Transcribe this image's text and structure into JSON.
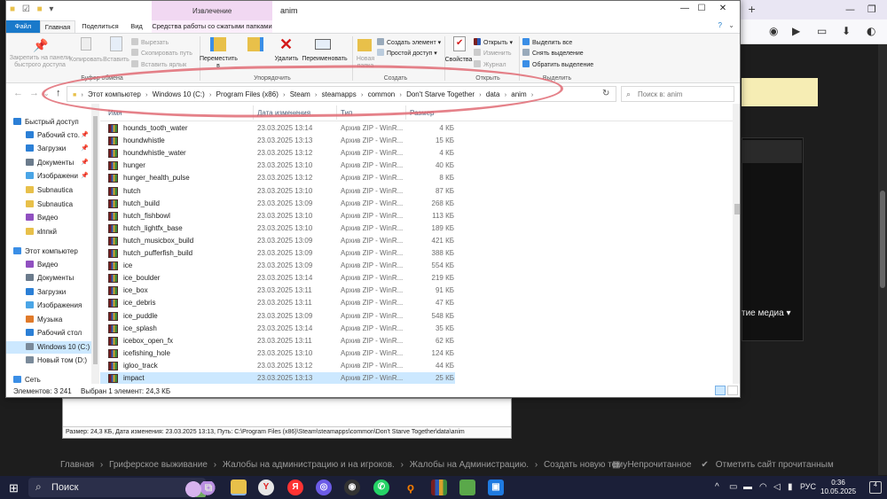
{
  "window": {
    "title": "anim",
    "context_tab": "Извлечение",
    "controls": {
      "minimize": "—",
      "maximize": "☐",
      "close": "✕"
    }
  },
  "ribbon_tabs": [
    "Файл",
    "Главная",
    "Поделиться",
    "Вид",
    "Средства работы со сжатыми папками"
  ],
  "ribbon": {
    "clipboard": {
      "pin_label": "Закрепить на панели быстрого доступа",
      "copy_label": "Копировать",
      "paste_label": "Вставить",
      "cut_label": "Вырезать",
      "copy_path_label": "Скопировать путь",
      "paste_shortcut_label": "Вставить ярлык",
      "group_label": "Буфер обмена"
    },
    "organize": {
      "move_label": "Переместить в",
      "copy_to_label": "Копировать в",
      "delete_label": "Удалить",
      "rename_label": "Переименовать",
      "group_label": "Упорядочить"
    },
    "create": {
      "new_folder_label": "Новая папка",
      "new_item_label": "Создать элемент",
      "easy_access_label": "Простой доступ",
      "group_label": "Создать"
    },
    "open": {
      "properties_label": "Свойства",
      "open_label": "Открыть",
      "edit_label": "Изменить",
      "history_label": "Журнал",
      "group_label": "Открыть"
    },
    "select": {
      "select_all_label": "Выделить все",
      "select_none_label": "Снять выделение",
      "invert_label": "Обратить выделение",
      "group_label": "Выделить"
    }
  },
  "address_bar": {
    "segments": [
      "Этот компьютер",
      "Windows 10 (C:)",
      "Program Files (x86)",
      "Steam",
      "steamapps",
      "common",
      "Don't Starve Together",
      "data",
      "anim"
    ],
    "search_placeholder": "Поиск в: anim"
  },
  "nav_pane": {
    "items": [
      {
        "label": "Быстрый доступ",
        "pinned": false
      },
      {
        "label": "Рабочий сто.",
        "pinned": true
      },
      {
        "label": "Загрузки",
        "pinned": true
      },
      {
        "label": "Документы",
        "pinned": true
      },
      {
        "label": "Изображени",
        "pinned": true
      },
      {
        "label": "Subnautica",
        "pinned": false
      },
      {
        "label": "Subnautica",
        "pinned": false
      },
      {
        "label": "Видео",
        "pinned": false
      },
      {
        "label": "кlппкй",
        "pinned": false
      },
      {
        "label": "Этот компьютер",
        "pinned": false
      },
      {
        "label": "Видео",
        "pinned": false
      },
      {
        "label": "Документы",
        "pinned": false
      },
      {
        "label": "Загрузки",
        "pinned": false
      },
      {
        "label": "Изображения",
        "pinned": false
      },
      {
        "label": "Музыка",
        "pinned": false
      },
      {
        "label": "Рабочий стол",
        "pinned": false
      },
      {
        "label": "Windows 10 (C:)",
        "pinned": false
      },
      {
        "label": "Новый том (D:)",
        "pinned": false
      },
      {
        "label": "Сеть",
        "pinned": false
      }
    ],
    "icon_colors": [
      "#2b7fd6",
      "#2b7fd6",
      "#2b7fd6",
      "#6b7b8c",
      "#4aa5e6",
      "#e8c04a",
      "#e8c04a",
      "#9050c0",
      "#e8c04a",
      "#3a8ee6",
      "#9050c0",
      "#6b7b8c",
      "#2b7fd6",
      "#4aa5e6",
      "#e07a2a",
      "#2b7fd6",
      "#7a8a9a",
      "#7a8a9a",
      "#3a8ee6"
    ]
  },
  "file_list": {
    "columns": {
      "name": "Имя",
      "date": "Дата изменения",
      "type": "Тип",
      "size": "Размер"
    },
    "rows": [
      {
        "name": "hounds_tooth_water",
        "date": "23.03.2025 13:14",
        "type": "Архив ZIP - WinR...",
        "size": "4 КБ"
      },
      {
        "name": "houndwhistle",
        "date": "23.03.2025 13:13",
        "type": "Архив ZIP - WinR...",
        "size": "15 КБ"
      },
      {
        "name": "houndwhistle_water",
        "date": "23.03.2025 13:12",
        "type": "Архив ZIP - WinR...",
        "size": "4 КБ"
      },
      {
        "name": "hunger",
        "date": "23.03.2025 13:10",
        "type": "Архив ZIP - WinR...",
        "size": "40 КБ"
      },
      {
        "name": "hunger_health_pulse",
        "date": "23.03.2025 13:12",
        "type": "Архив ZIP - WinR...",
        "size": "8 КБ"
      },
      {
        "name": "hutch",
        "date": "23.03.2025 13:10",
        "type": "Архив ZIP - WinR...",
        "size": "87 КБ"
      },
      {
        "name": "hutch_build",
        "date": "23.03.2025 13:09",
        "type": "Архив ZIP - WinR...",
        "size": "268 КБ"
      },
      {
        "name": "hutch_fishbowl",
        "date": "23.03.2025 13:10",
        "type": "Архив ZIP - WinR...",
        "size": "113 КБ"
      },
      {
        "name": "hutch_lightfx_base",
        "date": "23.03.2025 13:10",
        "type": "Архив ZIP - WinR...",
        "size": "189 КБ"
      },
      {
        "name": "hutch_musicbox_build",
        "date": "23.03.2025 13:09",
        "type": "Архив ZIP - WinR...",
        "size": "421 КБ"
      },
      {
        "name": "hutch_pufferfish_build",
        "date": "23.03.2025 13:09",
        "type": "Архив ZIP - WinR...",
        "size": "388 КБ"
      },
      {
        "name": "ice",
        "date": "23.03.2025 13:09",
        "type": "Архив ZIP - WinR...",
        "size": "554 КБ"
      },
      {
        "name": "ice_boulder",
        "date": "23.03.2025 13:14",
        "type": "Архив ZIP - WinR...",
        "size": "219 КБ"
      },
      {
        "name": "ice_box",
        "date": "23.03.2025 13:11",
        "type": "Архив ZIP - WinR...",
        "size": "91 КБ"
      },
      {
        "name": "ice_debris",
        "date": "23.03.2025 13:11",
        "type": "Архив ZIP - WinR...",
        "size": "47 КБ"
      },
      {
        "name": "ice_puddle",
        "date": "23.03.2025 13:09",
        "type": "Архив ZIP - WinR...",
        "size": "548 КБ"
      },
      {
        "name": "ice_splash",
        "date": "23.03.2025 13:14",
        "type": "Архив ZIP - WinR...",
        "size": "35 КБ"
      },
      {
        "name": "icebox_open_fx",
        "date": "23.03.2025 13:11",
        "type": "Архив ZIP - WinR...",
        "size": "62 КБ"
      },
      {
        "name": "icefishing_hole",
        "date": "23.03.2025 13:10",
        "type": "Архив ZIP - WinR...",
        "size": "124 КБ"
      },
      {
        "name": "igloo_track",
        "date": "23.03.2025 13:12",
        "type": "Архив ZIP - WinR...",
        "size": "44 КБ"
      },
      {
        "name": "impact",
        "date": "23.03.2025 13:13",
        "type": "Архив ZIP - WinR...",
        "size": "25 КБ"
      }
    ],
    "selected_index": 20
  },
  "status": {
    "count": "Элементов: 3 241",
    "selected": "Выбран 1 элемент: 24,3 КБ"
  },
  "background": {
    "editor_status": "Размер: 24,3 КБ, Дата изменения: 23.03.2025 13:13, Путь: C:\\Program Files (x86)\\Steam\\steamapps\\common\\Don't Starve Together\\data\\anim",
    "media_text": "тие медиа ▾",
    "breadcrumb": [
      "Главная",
      "Гриферское выживание",
      "Жалобы на администрацию и на игроков.",
      "Жалобы на Администрацию.",
      "Создать новую тему"
    ],
    "actions": [
      "Непрочитанное",
      "Отметить сайт прочитанным"
    ]
  },
  "taskbar": {
    "search_label": "Поиск",
    "language": "РУС",
    "time": "0:36",
    "date": "10.05.2025",
    "notifications": "4"
  },
  "colors": {
    "accent": "#1979ca",
    "selection": "#cce8ff",
    "annotation": "#e06b74",
    "context_tab": "#f1d8f2"
  }
}
